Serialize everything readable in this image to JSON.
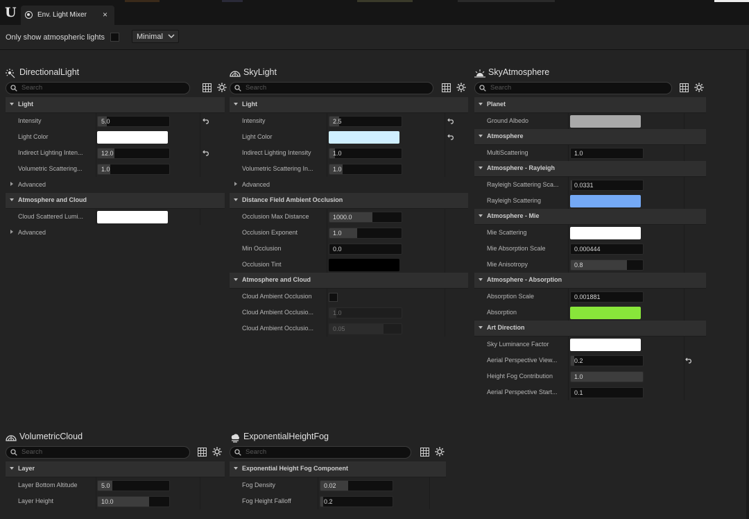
{
  "app": {
    "tab_title": "Env. Light Mixer",
    "logo_icon": "unreal-logo-icon",
    "close_glyph": "×"
  },
  "toolbar": {
    "atmospheric_label": "Only show atmospheric lights",
    "atmospheric_checked": false,
    "mode": "Minimal"
  },
  "search_placeholder": "Search",
  "panels": {
    "directional": {
      "title": "DirectionalLight",
      "rows": [
        {
          "type": "category",
          "label": "Light"
        },
        {
          "type": "prop",
          "label": "Intensity",
          "kind": "number",
          "value": "5.0",
          "fill": 0.13,
          "reset": true
        },
        {
          "type": "prop",
          "label": "Light Color",
          "kind": "color",
          "color": "#ffffff"
        },
        {
          "type": "prop",
          "label": "Indirect Lighting Inten...",
          "kind": "number",
          "value": "12.0",
          "fill": 0.23,
          "reset": true
        },
        {
          "type": "prop",
          "label": "Volumetric Scattering...",
          "kind": "number",
          "value": "1.0",
          "fill": 0.17
        },
        {
          "type": "advanced",
          "label": "Advanced"
        },
        {
          "type": "category",
          "label": "Atmosphere and Cloud"
        },
        {
          "type": "prop",
          "label": "Cloud Scattered Lumi...",
          "kind": "color",
          "color": "#ffffff"
        },
        {
          "type": "advanced",
          "label": "Advanced"
        }
      ]
    },
    "sky": {
      "title": "SkyLight",
      "rows": [
        {
          "type": "category",
          "label": "Light"
        },
        {
          "type": "prop",
          "label": "Intensity",
          "kind": "number",
          "value": "2.5",
          "fill": 0.13,
          "reset": true
        },
        {
          "type": "prop",
          "label": "Light Color",
          "kind": "color",
          "color": "#cfefff",
          "reset": true
        },
        {
          "type": "prop",
          "label": "Indirect Lighting Intensity",
          "kind": "number",
          "value": "1.0",
          "fill": 0.08
        },
        {
          "type": "prop",
          "label": "Volumetric Scattering In...",
          "kind": "number",
          "value": "1.0",
          "fill": 0.18
        },
        {
          "type": "advanced",
          "label": "Advanced"
        },
        {
          "type": "category",
          "label": "Distance Field Ambient Occlusion"
        },
        {
          "type": "prop",
          "label": "Occlusion Max Distance",
          "kind": "number",
          "value": "1000.0",
          "fill": 0.6
        },
        {
          "type": "prop",
          "label": "Occlusion Exponent",
          "kind": "number",
          "value": "1.0",
          "fill": 0.38
        },
        {
          "type": "prop",
          "label": "Min Occlusion",
          "kind": "number",
          "value": "0.0",
          "fill": 0
        },
        {
          "type": "prop",
          "label": "Occlusion Tint",
          "kind": "color",
          "color": "#000000"
        },
        {
          "type": "category",
          "label": "Atmosphere and Cloud"
        },
        {
          "type": "prop",
          "label": "Cloud Ambient Occlusion",
          "kind": "checkbox",
          "checked": false
        },
        {
          "type": "prop",
          "label": "Cloud Ambient Occlusio...",
          "kind": "number",
          "value": "1.0",
          "fill": 0.1,
          "dim": true
        },
        {
          "type": "prop",
          "label": "Cloud Ambient Occlusio...",
          "kind": "number",
          "value": "0.05",
          "fill": 0.75,
          "dim": true
        }
      ]
    },
    "skyatmo": {
      "title": "SkyAtmosphere",
      "rows": [
        {
          "type": "category",
          "label": "Planet"
        },
        {
          "type": "prop",
          "label": "Ground Albedo",
          "kind": "color",
          "color": "#a9a9a9"
        },
        {
          "type": "category",
          "label": "Atmosphere"
        },
        {
          "type": "prop",
          "label": "MultiScattering",
          "kind": "number",
          "value": "1.0",
          "fill": 0.0
        },
        {
          "type": "category",
          "label": "Atmosphere - Rayleigh"
        },
        {
          "type": "prop",
          "label": "Rayleigh Scattering Sca...",
          "kind": "number",
          "value": "0.0331",
          "fill": 0.02
        },
        {
          "type": "prop",
          "label": "Rayleigh Scattering",
          "kind": "color",
          "color": "#74a9f5"
        },
        {
          "type": "category",
          "label": "Atmosphere - Mie"
        },
        {
          "type": "prop",
          "label": "Mie Scattering",
          "kind": "color",
          "color": "#ffffff"
        },
        {
          "type": "prop",
          "label": "Mie Absorption Scale",
          "kind": "number",
          "value": "0.000444",
          "fill": 0
        },
        {
          "type": "prop",
          "label": "Mie Anisotropy",
          "kind": "number",
          "value": "0.8",
          "fill": 0.78
        },
        {
          "type": "category",
          "label": "Atmosphere - Absorption"
        },
        {
          "type": "prop",
          "label": "Absorption Scale",
          "kind": "number",
          "value": "0.001881",
          "fill": 0
        },
        {
          "type": "prop",
          "label": "Absorption",
          "kind": "color",
          "color": "#88e63a"
        },
        {
          "type": "category",
          "label": "Art Direction"
        },
        {
          "type": "prop",
          "label": "Sky Luminance Factor",
          "kind": "color",
          "color": "#ffffff"
        },
        {
          "type": "prop",
          "label": "Aerial Perspective View...",
          "kind": "number",
          "value": "0.2",
          "fill": 0.05,
          "reset": true
        },
        {
          "type": "prop",
          "label": "Height Fog Contribution",
          "kind": "number",
          "value": "1.0",
          "fill": 1.0
        },
        {
          "type": "prop",
          "label": "Aerial Perspective Start...",
          "kind": "number",
          "value": "0.1",
          "fill": 0
        }
      ]
    },
    "cloud": {
      "title": "VolumetricCloud",
      "rows": [
        {
          "type": "category",
          "label": "Layer"
        },
        {
          "type": "prop",
          "label": "Layer Bottom Altitude",
          "kind": "number",
          "value": "5.0",
          "fill": 0.2
        },
        {
          "type": "prop",
          "label": "Layer Height",
          "kind": "number",
          "value": "10.0",
          "fill": 0.72
        }
      ]
    },
    "fog": {
      "title": "ExponentialHeightFog",
      "rows": [
        {
          "type": "category",
          "label": "Exponential Height Fog Component"
        },
        {
          "type": "prop",
          "label": "Fog Density",
          "kind": "number",
          "value": "0.02",
          "fill": 0.38
        },
        {
          "type": "prop",
          "label": "Fog Height Falloff",
          "kind": "number",
          "value": "0.2",
          "fill": 0.04
        }
      ]
    }
  }
}
